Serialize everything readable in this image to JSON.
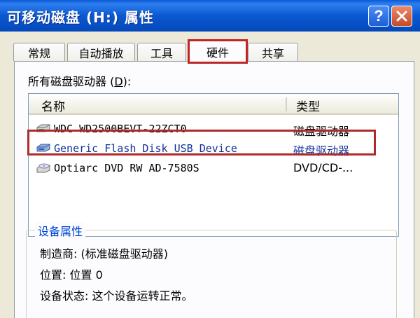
{
  "window": {
    "title": "可移动磁盘 (H:) 属性",
    "help_label": "?",
    "title_bar_color": "#0a58d0"
  },
  "tabs": [
    {
      "label": "常规",
      "active": false
    },
    {
      "label": "自动播放",
      "active": false
    },
    {
      "label": "工具",
      "active": false
    },
    {
      "label": "硬件",
      "active": true
    },
    {
      "label": "共享",
      "active": false
    }
  ],
  "hardware": {
    "section_label_prefix": "所有磁盘驱动器 (",
    "section_label_accel": "D",
    "section_label_suffix": "):",
    "columns": {
      "name": "名称",
      "type": "类型"
    },
    "devices": [
      {
        "name": "WDC WD2500BEVT-22ZCT0",
        "type": "磁盘驱动器",
        "icon": "hard-disk-icon"
      },
      {
        "name": "Generic Flash Disk USB Device",
        "type": "磁盘驱动器",
        "icon": "flash-disk-icon",
        "selected": true
      },
      {
        "name": "Optiarc DVD RW AD-7580S",
        "type": "DVD/CD-...",
        "icon": "dvd-drive-icon"
      }
    ],
    "device_properties": {
      "group_title": "设备属性",
      "manufacturer": "制造商: (标准磁盘驱动器)",
      "location": "位置: 位置 0",
      "status": "设备状态: 这个设备运转正常。"
    }
  },
  "highlight_color": "#c02525"
}
